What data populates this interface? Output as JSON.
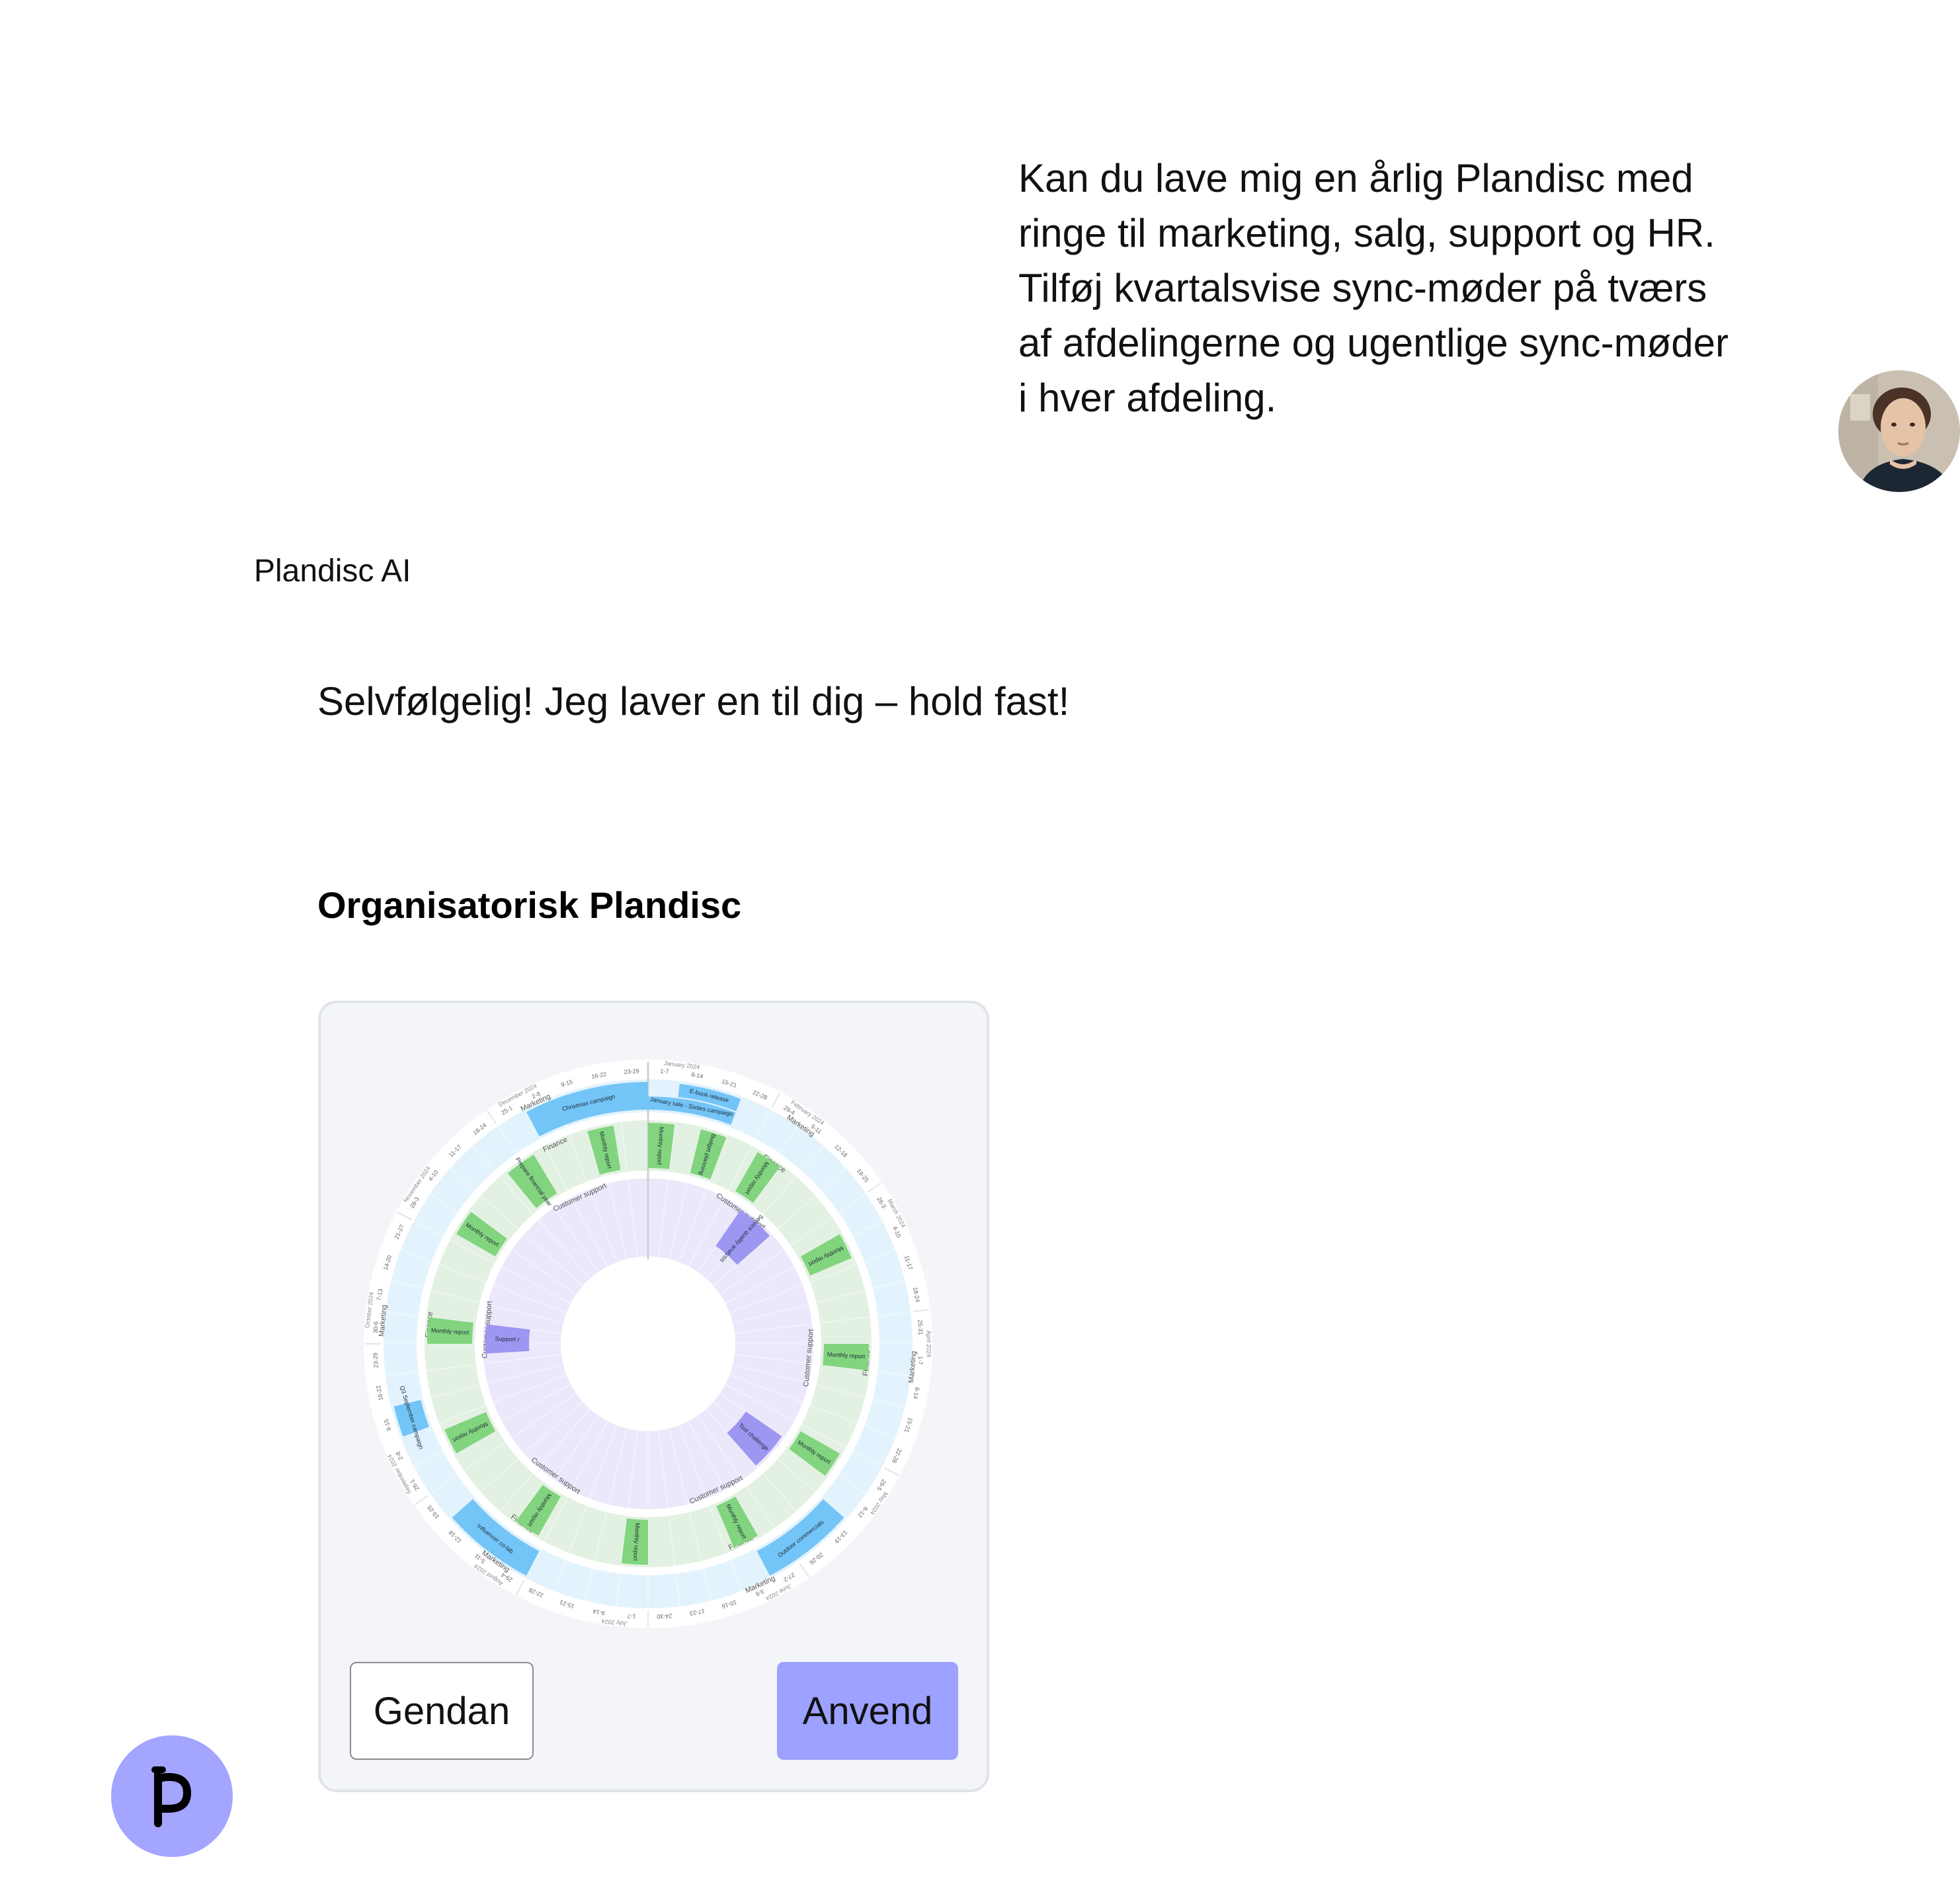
{
  "conversation": {
    "user_message": [
      "Kan du lave mig en årlig Plandisc med",
      "ringe til marketing, salg, support og HR.",
      "Tilføj kvartalsvise sync-møder på tværs",
      "af afdelingerne og ugentlige sync-møder",
      "i hver afdeling."
    ],
    "assistant_name": "Plandisc AI",
    "assistant_reply": "Selvfølgelig! Jeg laver en til dig – hold fast!"
  },
  "card": {
    "title": "Organisatorisk Plandisc",
    "reset_label": "Gendan",
    "apply_label": "Anvend"
  },
  "disc": {
    "months": [
      {
        "label": "January 2024",
        "weeks": [
          "1-7",
          "8-14",
          "15-21",
          "22-28"
        ]
      },
      {
        "label": "February 2024",
        "weeks": [
          "29-4",
          "5-11",
          "12-18",
          "19-25"
        ]
      },
      {
        "label": "March 2024",
        "weeks": [
          "26-3",
          "4-10",
          "11-17",
          "18-24"
        ]
      },
      {
        "label": "April 2024",
        "weeks": [
          "25-31",
          "1-7",
          "8-14",
          "15-21",
          "22-28"
        ]
      },
      {
        "label": "May 2024",
        "weeks": [
          "29-5",
          "6-12",
          "13-19",
          "20-26"
        ]
      },
      {
        "label": "June 2024",
        "weeks": [
          "27-2",
          "3-9",
          "10-16",
          "17-23",
          "24-30"
        ]
      },
      {
        "label": "July 2024",
        "weeks": [
          "1-7",
          "8-14",
          "15-21",
          "22-28"
        ]
      },
      {
        "label": "August 2024",
        "weeks": [
          "29-4",
          "5-11",
          "12-18",
          "19-25"
        ]
      },
      {
        "label": "September 2024",
        "weeks": [
          "26-1",
          "2-8",
          "9-15",
          "16-22",
          "23-29"
        ]
      },
      {
        "label": "October 2024",
        "weeks": [
          "30-6",
          "7-13",
          "14-20",
          "21-27"
        ]
      },
      {
        "label": "November 2024",
        "weeks": [
          "28-3",
          "4-10",
          "11-17",
          "18-24"
        ]
      },
      {
        "label": "December 2024",
        "weeks": [
          "25-1",
          "2-8",
          "9-15",
          "16-22",
          "23-29"
        ]
      }
    ],
    "rings": [
      {
        "name": "Marketing",
        "color": "#e3f3fd",
        "activity_color": "#74c5f7"
      },
      {
        "name": "Finance",
        "color": "#e3f1e3",
        "activity_color": "#82d47e"
      },
      {
        "name": "Customer support",
        "color": "#ebe8fb",
        "activity_color": "#9d97f2"
      }
    ],
    "ring_label_positions_deg": [
      35,
      95,
      155,
      215,
      275,
      335
    ],
    "activities": [
      {
        "ring": 0,
        "label": "E-book release",
        "start": 1,
        "end": 3,
        "lane": "outer"
      },
      {
        "ring": 0,
        "label": "January sale - Sixties campaign",
        "start": 0,
        "end": 3,
        "lane": "inner"
      },
      {
        "ring": 0,
        "label": "Outdoor commercials",
        "start": 19,
        "end": 22
      },
      {
        "ring": 0,
        "label": "Influencer co-lab",
        "start": 30,
        "end": 33
      },
      {
        "ring": 0,
        "label": "Q3 September campaign",
        "start": 36,
        "end": 37
      },
      {
        "ring": 0,
        "label": "Christmas campaign",
        "start": 48,
        "end": 52
      },
      {
        "ring": 1,
        "label": "Monthly report",
        "start": 0,
        "end": 1
      },
      {
        "ring": 1,
        "label": "Budget planning",
        "start": 2,
        "end": 3
      },
      {
        "ring": 1,
        "label": "Monthly report",
        "start": 4.3,
        "end": 5.3
      },
      {
        "ring": 1,
        "label": "Monthly report",
        "start": 8.7,
        "end": 9.7
      },
      {
        "ring": 1,
        "label": "Monthly report",
        "start": 13,
        "end": 14
      },
      {
        "ring": 1,
        "label": "Monthly report",
        "start": 17.3,
        "end": 18.3
      },
      {
        "ring": 1,
        "label": "Monthly report",
        "start": 21.7,
        "end": 22.7
      },
      {
        "ring": 1,
        "label": "Monthly report",
        "start": 26,
        "end": 27
      },
      {
        "ring": 1,
        "label": "Monthly report",
        "start": 30.3,
        "end": 31.3
      },
      {
        "ring": 1,
        "label": "Monthly report",
        "start": 34.7,
        "end": 35.7
      },
      {
        "ring": 1,
        "label": "Monthly report",
        "start": 39,
        "end": 40
      },
      {
        "ring": 1,
        "label": "Monthly report",
        "start": 43.3,
        "end": 44.3
      },
      {
        "ring": 1,
        "label": "Prepare financial year",
        "start": 46.3,
        "end": 47.5
      },
      {
        "ring": 1,
        "label": "Monthly report",
        "start": 49.7,
        "end": 50.7
      },
      {
        "ring": 2,
        "label": "Service quality analysis",
        "start": 5,
        "end": 7
      },
      {
        "ring": 2,
        "label": "Tool challenge",
        "start": 18,
        "end": 20
      },
      {
        "ring": 2,
        "label": "Support r",
        "start": 38.5,
        "end": 40
      }
    ]
  },
  "icons": {
    "user_avatar": "user-avatar-photo",
    "brand_logo": "plandisc-logo-icon"
  }
}
